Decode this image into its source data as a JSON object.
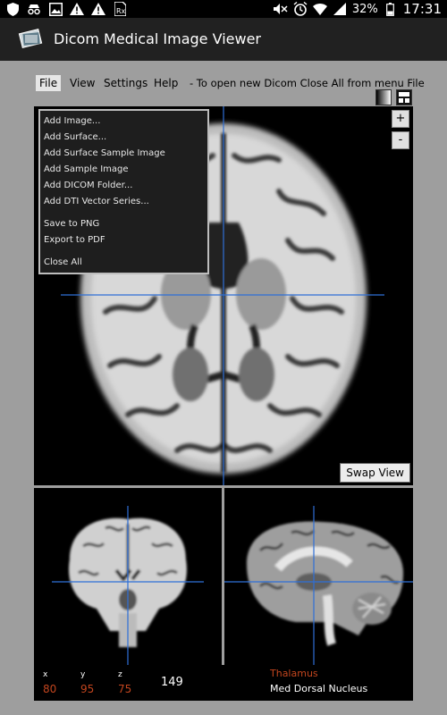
{
  "status_bar": {
    "time": "17:31",
    "battery": "32%",
    "left_icons": [
      "shield-icon",
      "incognito-icon",
      "image-icon",
      "warning-icon",
      "warning-icon",
      "prescription-icon"
    ],
    "right_icons": [
      "mute-icon",
      "alarm-icon",
      "wifi-icon",
      "signal-icon",
      "battery-icon"
    ]
  },
  "app": {
    "title": "Dicom Medical Image Viewer",
    "icon": "dicom-app-icon"
  },
  "menubar": {
    "items": [
      "File",
      "View",
      "Settings",
      "Help"
    ],
    "hint": "- To open new Dicom Close All from menu File"
  },
  "file_menu": {
    "items": [
      "Add Image...",
      "Add Surface...",
      "Add Surface Sample Image",
      "Add Sample Image",
      "Add DICOM Folder...",
      "Add DTI Vector Series...",
      "Save to PNG",
      "Export to PDF",
      "Close All"
    ]
  },
  "viewer": {
    "zoom_in": "+",
    "zoom_out": "-",
    "swap_view": "Swap View"
  },
  "info": {
    "x_label": "x",
    "y_label": "y",
    "z_label": "z",
    "x": "80",
    "y": "95",
    "z": "75",
    "slice": "149",
    "region": "Thalamus",
    "subregion": "Med Dorsal Nucleus"
  },
  "colors": {
    "crosshair": "#2f6fd6",
    "coord_value": "#c2451e",
    "app_bar": "#212121",
    "background": "#9e9e9e"
  }
}
